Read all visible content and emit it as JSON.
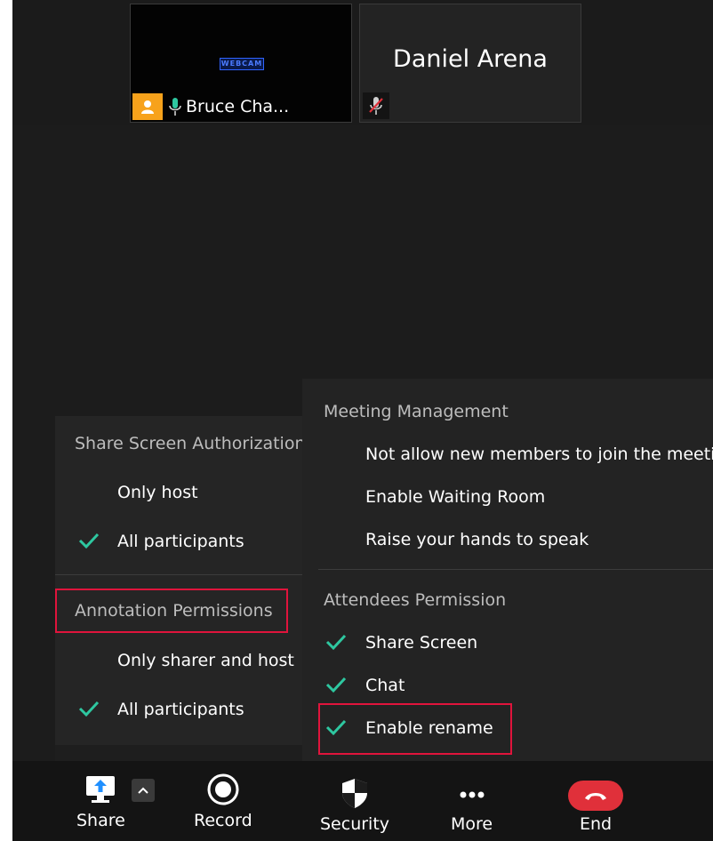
{
  "videos": [
    {
      "name": "Bruce Cha...",
      "logo_text": "WEBCAM",
      "host_badge_color": "#f7a21b"
    },
    {
      "name": "Daniel Arena"
    }
  ],
  "share_menu": {
    "share_screen_title": "Share Screen Authorization",
    "share_screen_options": [
      {
        "label": "Only host",
        "checked": false
      },
      {
        "label": "All participants",
        "checked": true
      }
    ],
    "annotation_title": "Annotation Permissions",
    "annotation_options": [
      {
        "label": "Only sharer and host",
        "checked": false
      },
      {
        "label": "All participants",
        "checked": true
      }
    ]
  },
  "security_menu": {
    "meeting_title": "Meeting Management",
    "meeting_items": [
      {
        "label": "Not allow new members to join the meeting"
      },
      {
        "label": "Enable Waiting Room"
      },
      {
        "label": "Raise your hands to speak"
      }
    ],
    "attendees_title": "Attendees Permission",
    "attendees_items": [
      {
        "label": "Share Screen",
        "checked": true
      },
      {
        "label": "Chat",
        "checked": true
      },
      {
        "label": "Enable rename",
        "checked": true
      }
    ]
  },
  "toolbar": {
    "share_label": "Share",
    "record_label": "Record",
    "security_label": "Security",
    "more_label": "More",
    "end_label": "End"
  },
  "colors": {
    "check": "#2ec7a0",
    "highlight": "#e0143c",
    "end": "#e0303a",
    "share_icon": "#1f8fff"
  }
}
